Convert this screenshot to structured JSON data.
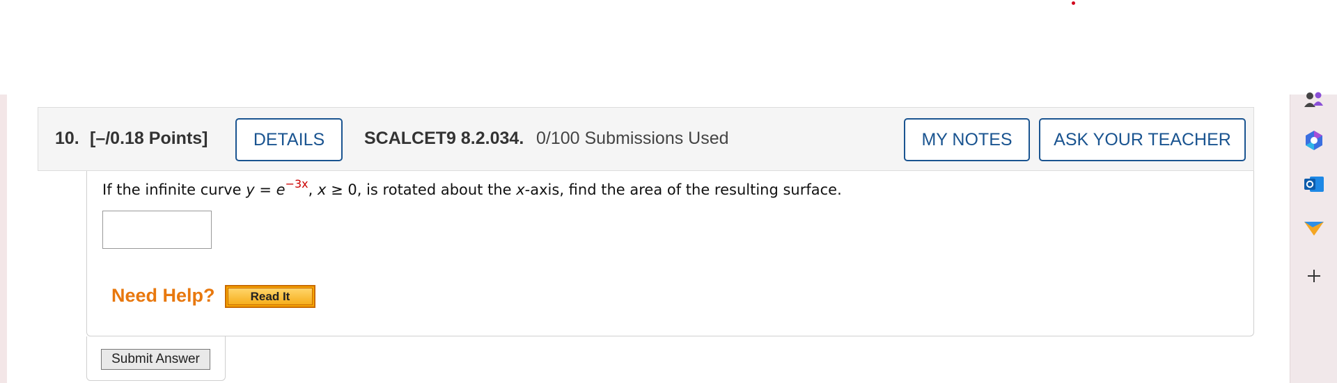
{
  "question": {
    "number": "10.",
    "points": "[–/0.18 Points]",
    "details_label": "DETAILS",
    "code": "SCALCET9 8.2.034.",
    "submissions": "0/100 Submissions Used",
    "my_notes_label": "MY NOTES",
    "ask_teacher_label": "ASK YOUR TEACHER",
    "text": {
      "intro": "If the infinite curve ",
      "y": "y",
      "eq": " = ",
      "e": "e",
      "exponent": "−3x",
      "after_exp": ", ",
      "x": "x",
      "cond": " ≥ 0, is rotated about the ",
      "x2": "x",
      "outro": "-axis, find the area of the resulting surface."
    },
    "answer_value": "",
    "need_help_label": "Need Help?",
    "read_it_label": "Read It",
    "submit_label": "Submit Answer"
  },
  "sidebar": {
    "icons": [
      "people-icon",
      "copilot-icon",
      "outlook-icon",
      "send-icon",
      "add-icon"
    ]
  },
  "colors": {
    "accent": "#1a5490",
    "need_help": "#e8780e",
    "exponent": "#cc0000"
  }
}
